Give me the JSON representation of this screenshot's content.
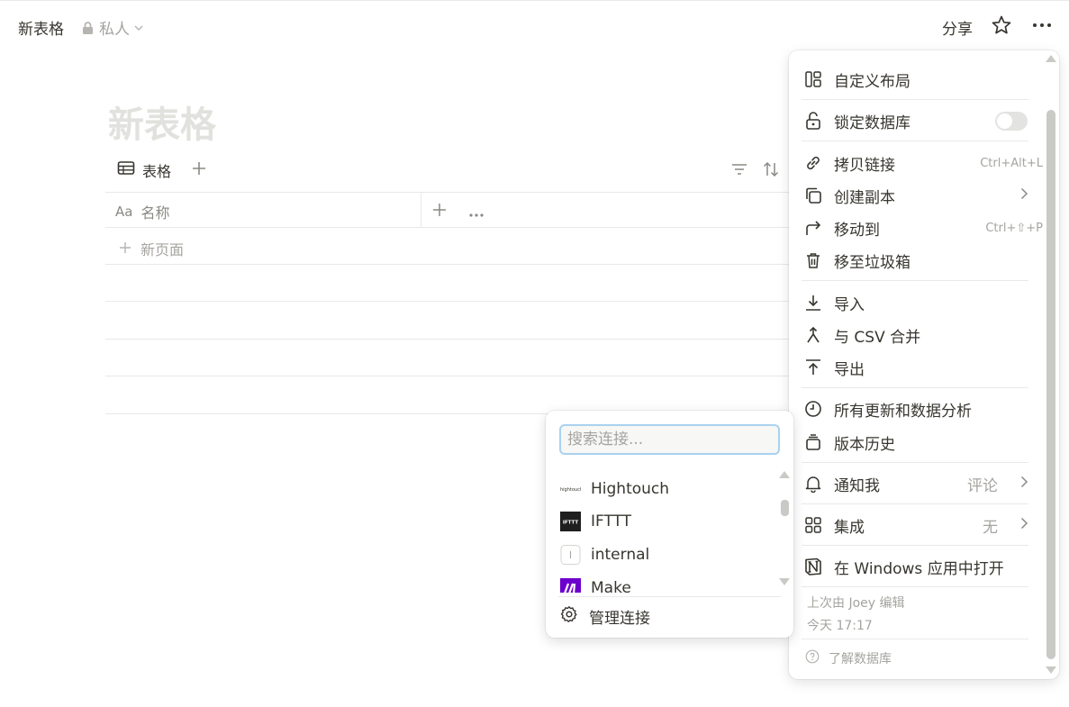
{
  "topbar": {
    "page_name": "新表格",
    "privacy_label": "私人",
    "share_label": "分享"
  },
  "page": {
    "title": "新表格",
    "view_tab_label": "表格",
    "column_prefix": "Aa",
    "column_name": "名称",
    "new_page_label": "新页面"
  },
  "menu": {
    "custom_layout": "自定义布局",
    "lock_database": "锁定数据库",
    "copy_link": "拷贝链接",
    "copy_link_shortcut": "Ctrl+Alt+L",
    "duplicate": "创建副本",
    "move_to": "移动到",
    "move_to_shortcut": "Ctrl+⇧+P",
    "trash": "移至垃圾箱",
    "import": "导入",
    "merge_csv": "与 CSV 合并",
    "export": "导出",
    "updates_analytics": "所有更新和数据分析",
    "version_history": "版本历史",
    "notify_me": "通知我",
    "notify_value": "评论",
    "integrations": "集成",
    "integrations_value": "无",
    "open_in_windows": "在 Windows 应用中打开",
    "last_edited": "上次由 Joey 编辑",
    "last_edited_time": "今天 17:17",
    "learn_databases": "了解数据库"
  },
  "submenu": {
    "search_placeholder": "搜索连接...",
    "items": [
      "Hightouch",
      "IFTTT",
      "internal",
      "Make"
    ],
    "hightouch_logo_text": "hightouch",
    "ifttt_logo_text": "IFTTT",
    "internal_logo_text": "I",
    "manage_label": "管理连接"
  },
  "colors": {
    "text": "#37352f",
    "muted": "#a5a4a0",
    "hover": "#efefed",
    "focus_ring": "#a9d2ef",
    "make_purple": "#6d00cc"
  }
}
